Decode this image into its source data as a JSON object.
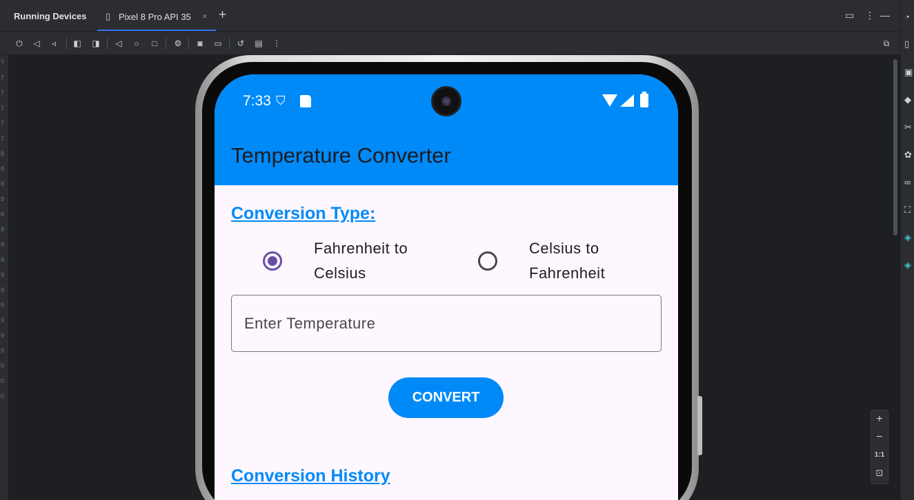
{
  "ide": {
    "panel_title": "Running Devices",
    "device_tab": "Pixel 8 Pro API 35",
    "tab_close": "×",
    "tab_add": "+",
    "gutter_numbers": [
      "7",
      "7",
      "7",
      "7",
      "7",
      "7",
      "8",
      "8",
      "8",
      "8",
      "8",
      "8",
      "8",
      "8",
      "9",
      "9",
      "9",
      "9",
      "9",
      "9",
      "0",
      "0",
      "0"
    ],
    "zoom": {
      "in": "+",
      "out": "−",
      "reset": "1:1"
    },
    "toolbar_icons": [
      "power-icon",
      "volume-up-icon",
      "volume-down-icon",
      "rotate-left-icon",
      "rotate-right-icon",
      "back-icon",
      "home-icon",
      "overview-icon",
      "device-settings-icon",
      "screenshot-icon",
      "screen-record-icon",
      "snapshot-icon",
      "mirror-icon",
      "more-icon"
    ]
  },
  "status_bar": {
    "time": "7:33"
  },
  "app": {
    "title": "Temperature Converter",
    "accent_color": "#008af8",
    "conversion_type_heading": "Conversion Type:",
    "options": [
      {
        "label": "Fahrenheit to Celsius",
        "selected": true
      },
      {
        "label": "Celsius to Fahrenheit",
        "selected": false
      }
    ],
    "input_placeholder": "Enter Temperature",
    "convert_button": "CONVERT",
    "history_heading": "Conversion History"
  }
}
